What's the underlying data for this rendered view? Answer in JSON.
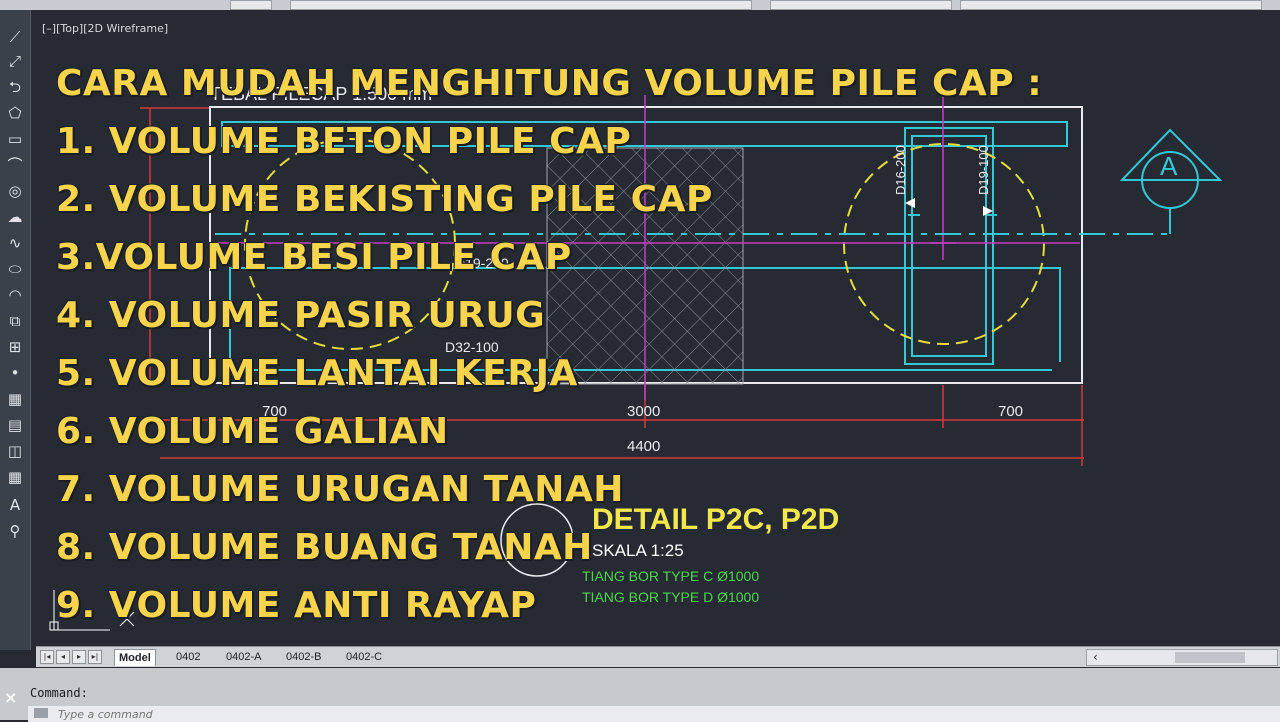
{
  "viewport": {
    "label": "[–][Top][2D Wireframe]"
  },
  "overlay": {
    "lines": [
      "CARA MUDAH MENGHITUNG VOLUME PILE CAP :",
      "1. VOLUME BETON PILE CAP",
      "2. VOLUME BEKISTING PILE CAP",
      "3.VOLUME BESI PILE CAP",
      "4. VOLUME PASIR URUG",
      "5. VOLUME LANTAI KERJA",
      "6. VOLUME GALIAN",
      "7. VOLUME URUGAN TANAH",
      "8. VOLUME BUANG TANAH",
      "9. VOLUME ANTI RAYAP"
    ]
  },
  "drawing": {
    "header_text": "TEBAL PILECAP 1.500 mm",
    "rebar_labels": [
      "D16-200",
      "D19-100",
      "D19-200",
      "D32-100"
    ],
    "section_marker": "A",
    "dimensions": {
      "left": "700",
      "middle": "3000",
      "right": "700",
      "total": "4400"
    },
    "detail_title": "DETAIL P2C, P2D",
    "detail_scale": "SKALA  1:25",
    "detail_pile_c": "TIANG BOR TYPE C Ø1000",
    "detail_pile_d": "TIANG BOR TYPE D Ø1000"
  },
  "tabs": {
    "items": [
      "Model",
      "0402",
      "0402-A",
      "0402-B",
      "0402-C"
    ],
    "active": "Model"
  },
  "command": {
    "label": "Command:",
    "placeholder": "Type a command"
  },
  "colors": {
    "background": "#262b33",
    "overlay_text": "#f7d44c",
    "cyan": "#33c8d8",
    "magenta": "#c43cc4",
    "red": "#d43a3a",
    "yellow_dash": "#e6dc3c",
    "white": "#e8eaed",
    "green_text": "#4cd64c"
  }
}
